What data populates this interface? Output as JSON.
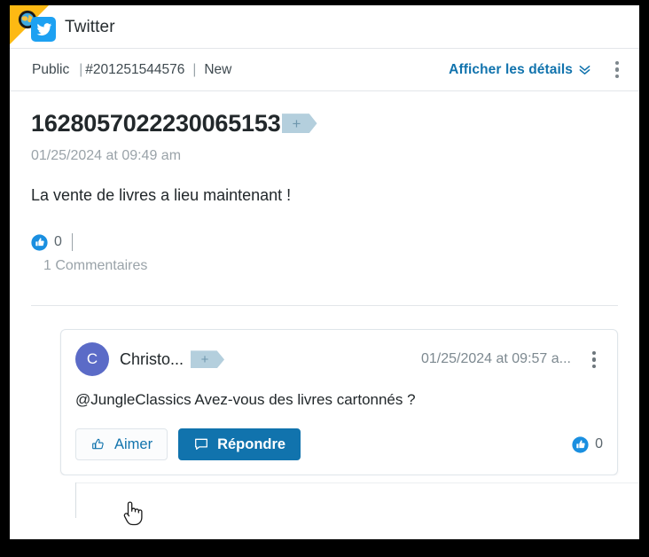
{
  "header": {
    "app_title": "Twitter",
    "globe_icon": "globe-icon",
    "brand_icon": "twitter-bird-icon",
    "corner_flag_color": "#fdb913",
    "brand_color": "#1da1f2"
  },
  "meta_bar": {
    "visibility": "Public",
    "separator_1": "|",
    "case_id": "#201251544576",
    "separator_2": "|",
    "status": "New",
    "details_link": "Afficher les détails",
    "details_chevron_icon": "chevron-double-down-icon",
    "more_menu_icon": "kebab-menu-icon",
    "link_color": "#1173ad"
  },
  "post": {
    "title": "1628057022230065153",
    "title_tag": "+",
    "date": "01/25/2024 at 09:49 am",
    "text": "La vente de livres a lieu maintenant !",
    "like_icon": "thumbs-up-filled-icon",
    "like_count": "0",
    "comment_count": "1 Commentaires"
  },
  "comment": {
    "avatar_initial": "C",
    "avatar_color": "#5b6bc7",
    "author": "Christo...",
    "author_tag": "+",
    "timestamp": "01/25/2024 at 09:57 a...",
    "more_menu_icon": "kebab-menu-icon",
    "text": "@JungleClassics Avez-vous des livres cartonnés ?",
    "like_button_label": "Aimer",
    "like_button_icon": "thumbs-up-outline-icon",
    "reply_button_label": "Répondre",
    "reply_button_icon": "speech-bubble-icon",
    "like_badge_icon": "thumbs-up-filled-icon",
    "like_count": "0",
    "primary_button_color": "#1173ad"
  },
  "cursor": {
    "icon": "hand-pointer-cursor"
  }
}
